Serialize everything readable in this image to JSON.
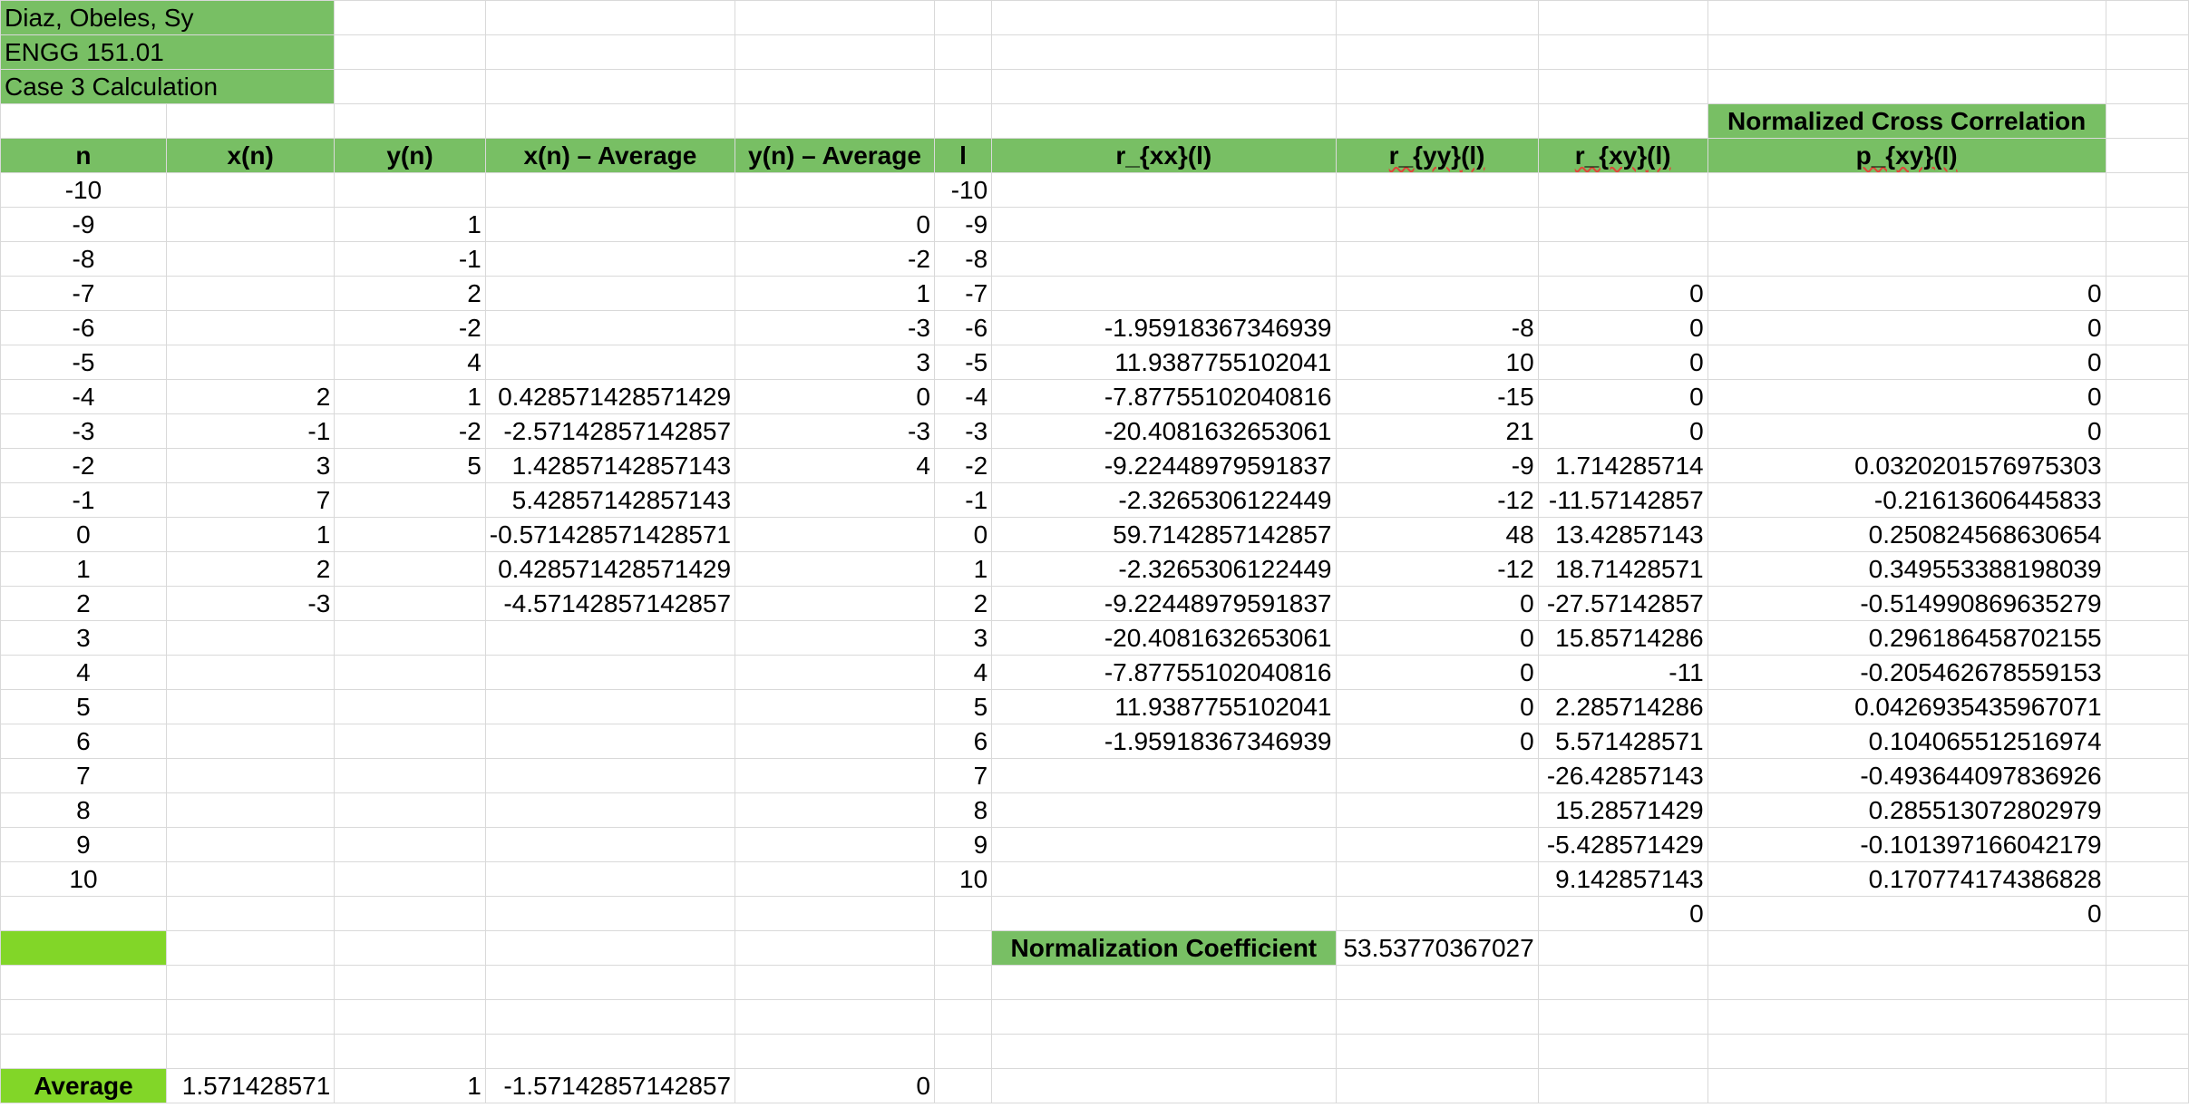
{
  "colors": {
    "header_green": "#78bf64",
    "bright_green": "#82d628",
    "grid": "#d9d9d9",
    "spell_underline": "#e0463a"
  },
  "info": [
    "Diaz, Obeles, Sy",
    "ENGG 151.01",
    "Case 3 Calculation"
  ],
  "headers": {
    "above_j": "Normalized Cross Correlation",
    "cols": [
      "n",
      "x(n)",
      "y(n)",
      "x(n) – Average",
      "y(n) – Average",
      "l",
      "r_{xx}(l)",
      "r_{yy}(l)",
      "r_{xy}(l)",
      "p_{xy}(l)"
    ]
  },
  "rows": [
    [
      "-10",
      "",
      "",
      "",
      "",
      "-10",
      "",
      "",
      "",
      ""
    ],
    [
      "-9",
      "",
      "1",
      "",
      "0",
      "-9",
      "",
      "",
      "",
      ""
    ],
    [
      "-8",
      "",
      "-1",
      "",
      "-2",
      "-8",
      "",
      "",
      "",
      ""
    ],
    [
      "-7",
      "",
      "2",
      "",
      "1",
      "-7",
      "",
      "",
      "0",
      "0"
    ],
    [
      "-6",
      "",
      "-2",
      "",
      "-3",
      "-6",
      "-1.95918367346939",
      "-8",
      "0",
      "0"
    ],
    [
      "-5",
      "",
      "4",
      "",
      "3",
      "-5",
      "11.9387755102041",
      "10",
      "0",
      "0"
    ],
    [
      "-4",
      "2",
      "1",
      "0.428571428571429",
      "0",
      "-4",
      "-7.87755102040816",
      "-15",
      "0",
      "0"
    ],
    [
      "-3",
      "-1",
      "-2",
      "-2.57142857142857",
      "-3",
      "-3",
      "-20.4081632653061",
      "21",
      "0",
      "0"
    ],
    [
      "-2",
      "3",
      "5",
      "1.42857142857143",
      "4",
      "-2",
      "-9.22448979591837",
      "-9",
      "1.714285714",
      "0.0320201576975303"
    ],
    [
      "-1",
      "7",
      "",
      "5.42857142857143",
      "",
      "-1",
      "-2.3265306122449",
      "-12",
      "-11.57142857",
      "-0.21613606445833"
    ],
    [
      "0",
      "1",
      "",
      "-0.571428571428571",
      "",
      "0",
      "59.7142857142857",
      "48",
      "13.42857143",
      "0.250824568630654"
    ],
    [
      "1",
      "2",
      "",
      "0.428571428571429",
      "",
      "1",
      "-2.3265306122449",
      "-12",
      "18.71428571",
      "0.349553388198039"
    ],
    [
      "2",
      "-3",
      "",
      "-4.57142857142857",
      "",
      "2",
      "-9.22448979591837",
      "0",
      "-27.57142857",
      "-0.514990869635279"
    ],
    [
      "3",
      "",
      "",
      "",
      "",
      "3",
      "-20.4081632653061",
      "0",
      "15.85714286",
      "0.296186458702155"
    ],
    [
      "4",
      "",
      "",
      "",
      "",
      "4",
      "-7.87755102040816",
      "0",
      "-11",
      "-0.205462678559153"
    ],
    [
      "5",
      "",
      "",
      "",
      "",
      "5",
      "11.9387755102041",
      "0",
      "2.285714286",
      "0.0426935435967071"
    ],
    [
      "6",
      "",
      "",
      "",
      "",
      "6",
      "-1.95918367346939",
      "0",
      "5.571428571",
      "0.104065512516974"
    ],
    [
      "7",
      "",
      "",
      "",
      "",
      "7",
      "",
      "",
      "-26.42857143",
      "-0.493644097836926"
    ],
    [
      "8",
      "",
      "",
      "",
      "",
      "8",
      "",
      "",
      "15.28571429",
      "0.285513072802979"
    ],
    [
      "9",
      "",
      "",
      "",
      "",
      "9",
      "",
      "",
      "-5.428571429",
      "-0.101397166042179"
    ],
    [
      "10",
      "",
      "",
      "",
      "",
      "10",
      "",
      "",
      "9.142857143",
      "0.170774174386828"
    ],
    [
      "",
      "",
      "",
      "",
      "",
      "",
      "",
      "",
      "0",
      "0"
    ]
  ],
  "normalization": {
    "label": "Normalization Coefficient",
    "value": "53.53770367027"
  },
  "average": {
    "label": "Average",
    "values": [
      "1.571428571",
      "1",
      "-1.57142857142857",
      "0"
    ]
  }
}
